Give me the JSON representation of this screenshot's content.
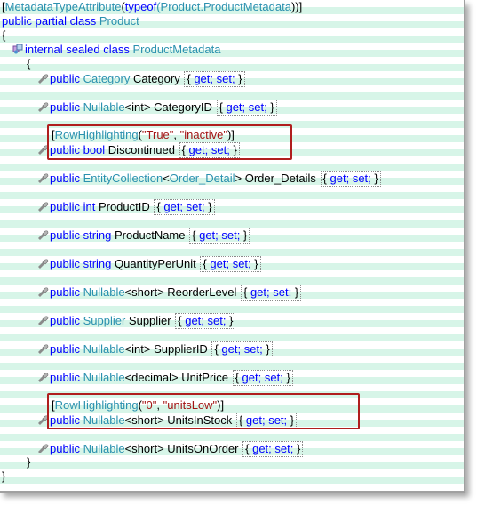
{
  "colors": {
    "keyword": "#0000ff",
    "type": "#2b91af",
    "string": "#a31515",
    "highlight": "#b01e1e"
  },
  "icons": {
    "property": "property-wrench-icon",
    "class": "class-icon"
  },
  "code": {
    "attr_line": {
      "open": "[",
      "attr": "MetadataTypeAttribute",
      "paren": "(",
      "typeof": "typeof",
      "arg": "(Product.ProductMetadata",
      "close": "))]"
    },
    "class_decl": {
      "public": "public",
      "partial": "partial",
      "class": "class",
      "name": "Product"
    },
    "open_brace": "{",
    "inner_decl": {
      "internal": "internal",
      "sealed": "sealed",
      "class": "class",
      "name": "ProductMetadata"
    },
    "inner_open": "{",
    "inner_close": "}",
    "close_brace": "}",
    "get": "get;",
    "set": "set;",
    "prop_open": "{",
    "prop_close": "}",
    "public": "public",
    "props": [
      {
        "type": "Category",
        "name": "Category"
      },
      {
        "type_prefix": "Nullable",
        "generic": "<int>",
        "name": "CategoryID"
      },
      {
        "kw_type": "bool",
        "name": "Discontinued",
        "attr": {
          "open": "[",
          "name": "RowHighlighting",
          "p1": "(",
          "v1": "\"True\"",
          "comma": ", ",
          "v2": "\"inactive\"",
          "p2": ")]"
        }
      },
      {
        "type_prefix": "EntityCollection",
        "generic_open": "<",
        "generic_type": "Order_Detail",
        "generic_close": ">",
        "name": "Order_Details"
      },
      {
        "kw_type": "int",
        "name": "ProductID"
      },
      {
        "kw_type": "string",
        "name": "ProductName"
      },
      {
        "kw_type": "string",
        "name": "QuantityPerUnit"
      },
      {
        "type_prefix": "Nullable",
        "generic": "<short>",
        "name": "ReorderLevel"
      },
      {
        "type": "Supplier",
        "name": "Supplier"
      },
      {
        "type_prefix": "Nullable",
        "generic": "<int>",
        "name": "SupplierID"
      },
      {
        "type_prefix": "Nullable",
        "generic": "<decimal>",
        "name": "UnitPrice"
      },
      {
        "type_prefix": "Nullable",
        "generic": "<short>",
        "name": "UnitsInStock",
        "attr": {
          "open": "[",
          "name": "RowHighlighting",
          "p1": "(",
          "v1": "\"0\"",
          "comma": ", ",
          "v2": "\"unitsLow\"",
          "p2": ")]"
        }
      },
      {
        "type_prefix": "Nullable",
        "generic": "<short>",
        "name": "UnitsOnOrder"
      }
    ]
  }
}
